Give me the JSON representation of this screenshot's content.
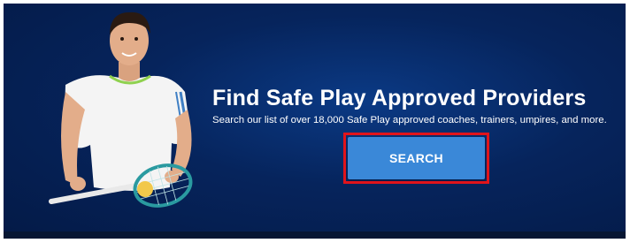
{
  "banner": {
    "title": "Find Safe Play Approved Providers",
    "subtitle": "Search our list of over 18,000 Safe Play approved coaches, trainers, umpires, and more.",
    "search_label": "SEARCH",
    "image": "tennis-player-illustration"
  },
  "colors": {
    "background": "#06245c",
    "button": "#3a88d8",
    "highlight_outline": "#e1141b",
    "text": "#ffffff"
  }
}
